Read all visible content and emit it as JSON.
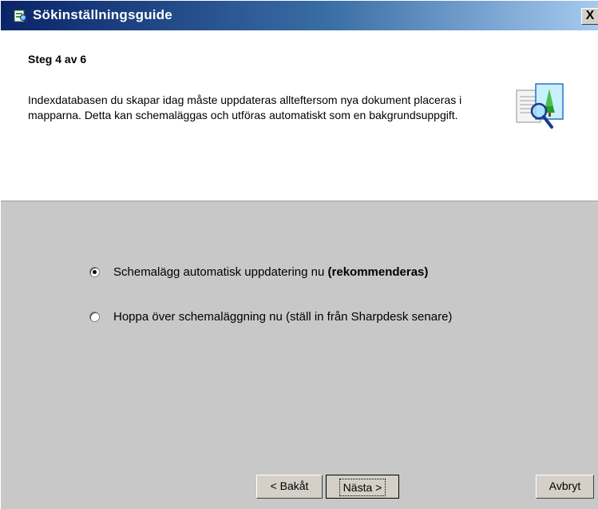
{
  "window": {
    "title": "Sökinställningsguide",
    "close_label": "X",
    "icons": {
      "app": "search-settings-wizard-icon",
      "header": "document-search-icon",
      "close": "close-icon"
    }
  },
  "header": {
    "step": "Steg 4 av 6",
    "description": "Indexdatabasen du skapar idag måste uppdateras allteftersom nya dokument placeras i mapparna. Detta kan schemaläggas och utföras automatiskt som en bakgrundsuppgift."
  },
  "options": [
    {
      "label": "Schemalägg automatisk uppdatering nu ",
      "emphasis": "(rekommenderas)",
      "selected": true
    },
    {
      "label": "Hoppa över schemaläggning nu (ställ in från Sharpdesk senare)",
      "emphasis": "",
      "selected": false
    }
  ],
  "buttons": {
    "back": "< Bakåt",
    "next": "Nästa >",
    "cancel": "Avbryt"
  },
  "colors": {
    "titlebar_start": "#0a246a",
    "titlebar_end": "#a6caf0",
    "dialog_background": "#c8c8c8",
    "header_background": "#ffffff"
  }
}
